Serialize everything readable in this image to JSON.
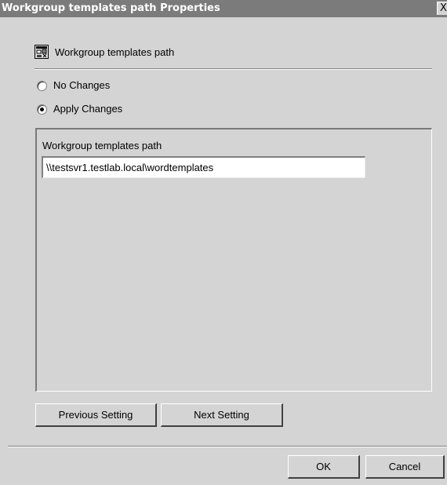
{
  "window": {
    "title": "Workgroup templates path Properties",
    "close_label": "X"
  },
  "header": {
    "icon": "policy-settings-icon",
    "label": "Workgroup templates path"
  },
  "options": [
    {
      "label": "No Changes",
      "selected": false
    },
    {
      "label": "Apply Changes",
      "selected": true
    }
  ],
  "settings_panel": {
    "field_label": "Workgroup templates path",
    "field_value": "\\\\testsvr1.testlab.local\\wordtemplates"
  },
  "navigation": {
    "previous_label": "Previous Setting",
    "next_label": "Next Setting"
  },
  "footer": {
    "ok_label": "OK",
    "cancel_label": "Cancel"
  },
  "colors": {
    "titlebar": "#7b7b7b",
    "face": "#d4d4d4"
  }
}
